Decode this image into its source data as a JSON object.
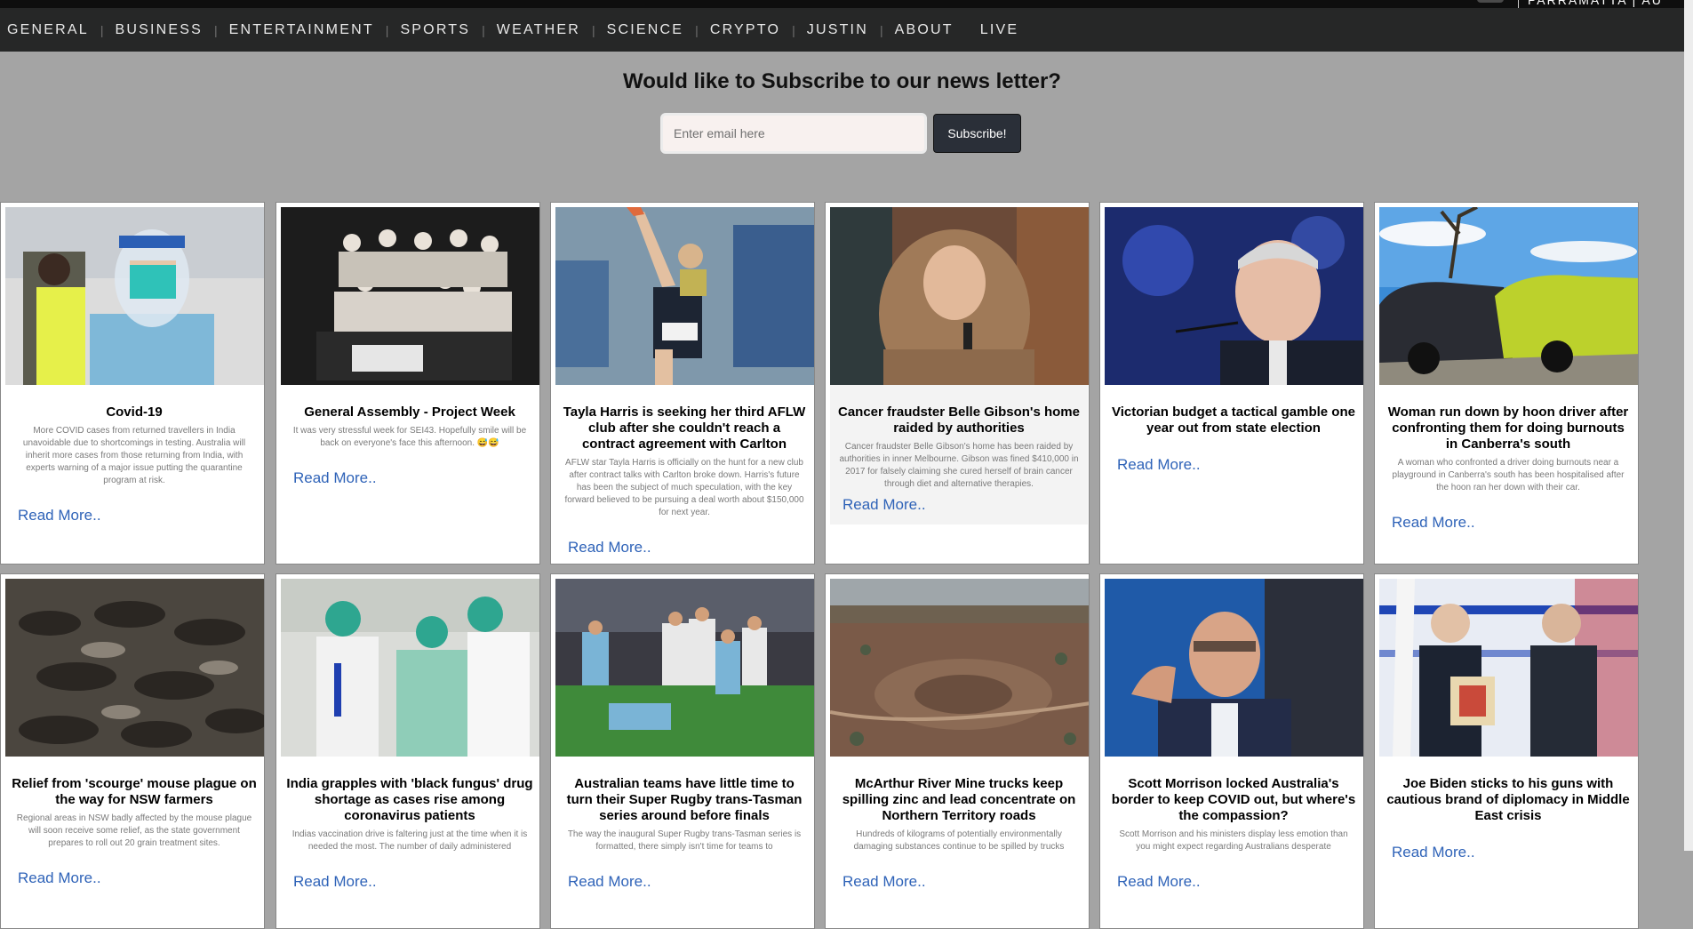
{
  "header": {
    "location": "PARRAMATTA | AU"
  },
  "nav": [
    "GENERAL",
    "BUSINESS",
    "ENTERTAINMENT",
    "SPORTS",
    "WEATHER",
    "SCIENCE",
    "CRYPTO",
    "JUSTIN",
    "ABOUT",
    "LIVE"
  ],
  "subscribe": {
    "title": "Would like to Subscribe to our news letter?",
    "placeholder": "Enter email here",
    "button": "Subscribe!"
  },
  "read_more": "Read More..",
  "articles": [
    {
      "title": "Covid-19",
      "desc": "More COVID cases from returned travellers in India unavoidable due to shortcomings in testing. Australia will inherit more cases from those returning from India, with experts warning of a major issue putting the quarantine program at risk.",
      "image": "healthcare-worker-face-shield"
    },
    {
      "title": "General Assembly - Project Week",
      "desc": "It was very stressful week for SEI43. Hopefully smile will be back on everyone's face this afternoon. 😅😅",
      "image": "group-photo"
    },
    {
      "title": "Tayla Harris is seeking her third AFLW club after she couldn't reach a contract agreement with Carlton",
      "desc": "AFLW star Tayla Harris is officially on the hunt for a new club after contract talks with Carlton broke down. Harris's future has been the subject of much speculation, with the key forward believed to be pursuing a deal worth about $150,000 for next year.",
      "image": "footballer-kicking"
    },
    {
      "title": "Cancer fraudster Belle Gibson's home raided by authorities",
      "desc": "Cancer fraudster Belle Gibson's home has been raided by authorities in inner Melbourne. Gibson was fined $410,000 in 2017 for falsely claiming she cured herself of brain cancer through diet and alternative therapies.",
      "image": "woman-headscarf-microphone"
    },
    {
      "title": "Victorian budget a tactical gamble one year out from state election",
      "desc": "",
      "image": "politician-at-lectern"
    },
    {
      "title": "Woman run down by hoon driver after confronting them for doing burnouts in Canberra's south",
      "desc": "A woman who confronted a driver doing burnouts near a playground in Canberra's south has been hospitalised after the hoon ran her down with their car.",
      "image": "two-parked-cars"
    },
    {
      "title": "Relief from 'scourge' mouse plague on the way for NSW farmers",
      "desc": "Regional areas in NSW badly affected by the mouse plague will soon receive some relief, as the state government prepares to roll out 20 grain treatment sites.",
      "image": "dead-mice"
    },
    {
      "title": "India grapples with 'black fungus' drug shortage as cases rise among coronavirus patients",
      "desc": "Indias vaccination drive is faltering just at the time when it is needed the most. The number of daily administered",
      "image": "nurses-vaccination"
    },
    {
      "title": "Australian teams have little time to turn their Super Rugby trans-Tasman series around before finals",
      "desc": "The way the inaugural Super Rugby trans-Tasman series is formatted, there simply isn't time for teams to",
      "image": "rugby-players"
    },
    {
      "title": "McArthur River Mine trucks keep spilling zinc and lead concentrate on Northern Territory roads",
      "desc": "Hundreds of kilograms of potentially environmentally damaging substances continue to be spilled by trucks",
      "image": "aerial-mine-site"
    },
    {
      "title": "Scott Morrison locked Australia's border to keep COVID out, but where's the compassion?",
      "desc": "Scott Morrison and his ministers display less emotion than you might expect regarding Australians desperate",
      "image": "prime-minister-speaking"
    },
    {
      "title": "Joe Biden sticks to his guns with cautious brand of diplomacy in Middle East crisis",
      "desc": "",
      "image": "leaders-handshake-flags"
    }
  ]
}
